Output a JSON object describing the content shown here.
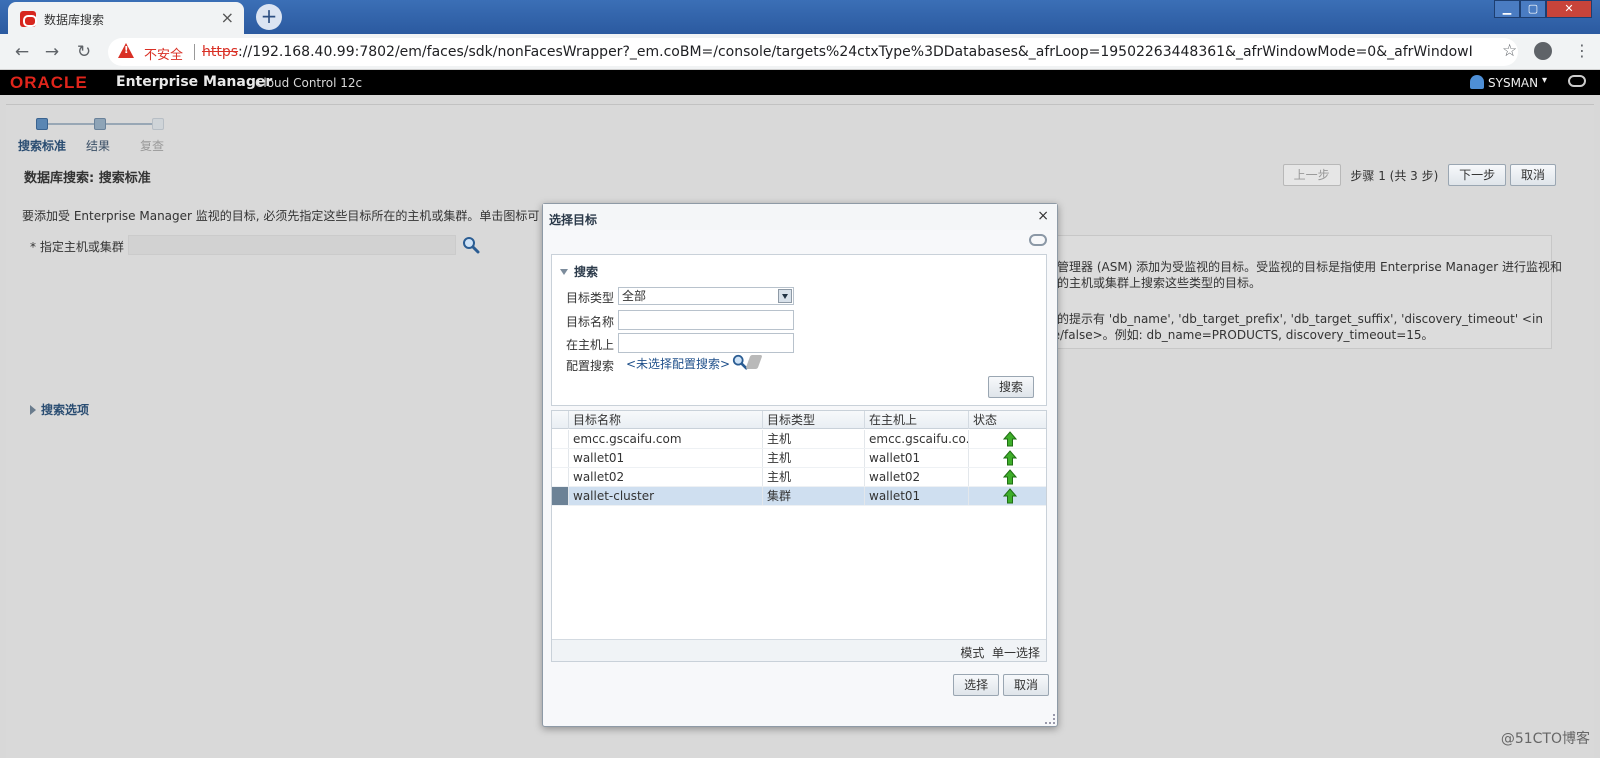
{
  "browser": {
    "tab_title": "数据库搜索",
    "tab_close": "×",
    "new_tab": "+",
    "back": "←",
    "forward": "→",
    "reload": "↻",
    "insecure_label": "不安全",
    "url_scheme": "https",
    "url_rest": "://192.168.40.99:7802/em/faces/sdk/nonFacesWrapper?_em.coBM=/console/targets%24ctxType%3DDatabases&_afrLoop=19502263448361&_afrWindowMode=0&_afrWindowId=null...",
    "star": "☆",
    "menu": "⋮",
    "minimize": "▁",
    "maximize": "▢",
    "close": "✕"
  },
  "em_header": {
    "logo": "ORACLE",
    "product": "Enterprise Manager",
    "subtitle": "Cloud Control 12c",
    "user": "SYSMAN",
    "user_caret": "▾"
  },
  "train": {
    "steps": [
      {
        "label": "搜索标准",
        "state": "active"
      },
      {
        "label": "结果",
        "state": "done"
      },
      {
        "label": "复查",
        "state": "off"
      }
    ]
  },
  "page": {
    "title": "数据库搜索: 搜索标准",
    "back_button": "上一步",
    "step_text": "步骤 1 (共 3 步)",
    "next_button": "下一步",
    "cancel_button": "取消",
    "intro": "要添加受 Enterprise Manager 监视的目标, 必须先指定这些目标所在的主机或集群。单击图标可选",
    "host_label": "* 指定主机或集群",
    "info_line1": "储管理器 (ASM) 添加为受监视的目标。受监视的目标是指使用 Enterprise Manager 进行监视和",
    "info_line2": "定的主机或集群上搜索这些类型的目标。",
    "info_line3": "持的提示有 'db_name', 'db_target_prefix', 'db_target_suffix', 'discovery_timeout' <in",
    "info_line4": "ue/false>。例如: db_name=PRODUCTS, discovery_timeout=15。",
    "search_options": "搜索选项",
    "watermark": "@51CTO博客"
  },
  "dialog": {
    "title": "选择目标",
    "close": "×",
    "search_panel_title": "搜索",
    "target_type_label": "目标类型",
    "target_type_value": "全部",
    "target_name_label": "目标名称",
    "on_host_label": "在主机上",
    "config_search_label": "配置搜索",
    "config_search_link": "<未选择配置搜索>",
    "search_button": "搜索",
    "columns": [
      "目标名称",
      "目标类型",
      "在主机上",
      "状态"
    ],
    "rows": [
      {
        "name": "emcc.gscaifu.com",
        "type": "主机",
        "host": "emcc.gscaifu.co...",
        "status": "up",
        "selected": false
      },
      {
        "name": "wallet01",
        "type": "主机",
        "host": "wallet01",
        "status": "up",
        "selected": false
      },
      {
        "name": "wallet02",
        "type": "主机",
        "host": "wallet02",
        "status": "up",
        "selected": false
      },
      {
        "name": "wallet-cluster",
        "type": "集群",
        "host": "wallet01",
        "status": "up",
        "selected": true
      }
    ],
    "mode_label": "模式",
    "mode_value": "单一选择",
    "select_button": "选择",
    "cancel_button": "取消"
  },
  "colors": {
    "status_up": "#2e9e1f",
    "oracle_red": "#e0251b",
    "selected_row": "#cfdff0"
  }
}
